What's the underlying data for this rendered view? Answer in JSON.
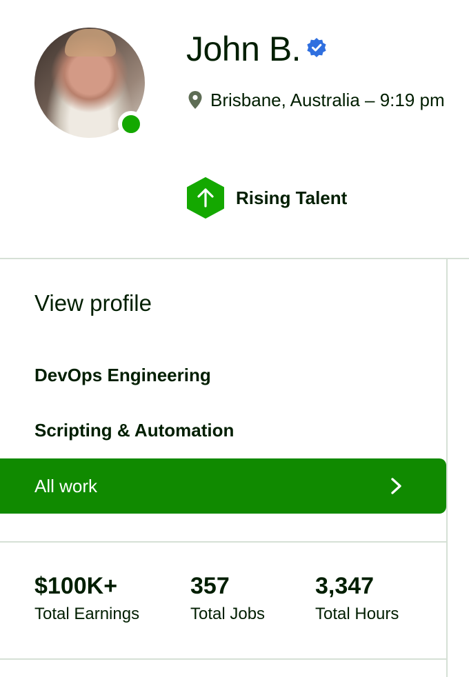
{
  "profile": {
    "name": "John B.",
    "location": "Brisbane, Australia – 9:19 pm",
    "status": "online",
    "badge": "Rising Talent",
    "colors": {
      "brand_green": "#108a00",
      "online": "#14a800",
      "verified": "#2f6fdf",
      "text": "#001e00"
    }
  },
  "sidebar": {
    "heading": "View profile",
    "items": [
      {
        "label": "DevOps Engineering"
      },
      {
        "label": "Scripting & Automation"
      },
      {
        "label": "All work",
        "selected": true
      }
    ]
  },
  "stats": [
    {
      "value": "$100K+",
      "label": "Total Earnings"
    },
    {
      "value": "357",
      "label": "Total Jobs"
    },
    {
      "value": "3,347",
      "label": "Total Hours"
    }
  ],
  "icons": [
    "verified-badge-icon",
    "location-pin-icon",
    "rising-talent-icon",
    "chevron-right-icon"
  ]
}
